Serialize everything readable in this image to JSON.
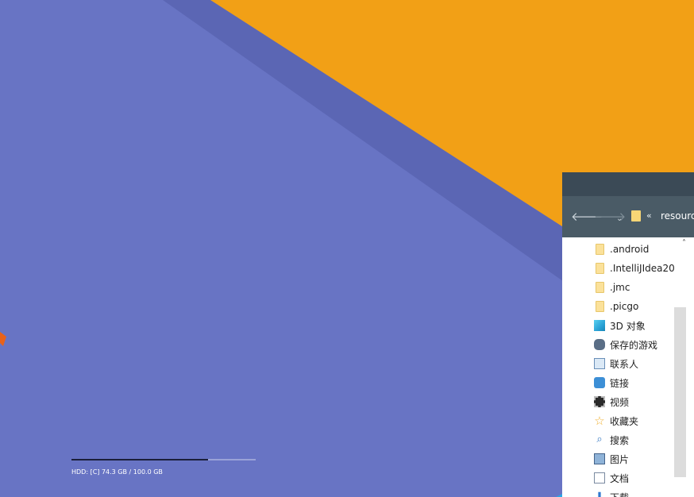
{
  "desktop": {
    "colors": {
      "background": "#6874c4",
      "shadow": "#5b66b4",
      "accent": "#f2a016",
      "blue_corner": "#29a6e6"
    },
    "hdd_widget": {
      "label": "HDD: [C] 74.3 GB / 100.0 GB",
      "used_fraction": 0.743
    }
  },
  "explorer": {
    "nav": {
      "back_icon": "arrow-left",
      "forward_icon": "arrow-right",
      "recent_icon": "chevron-down",
      "address_separator": "«",
      "address_text": "resourc"
    },
    "tree_items": [
      {
        "label": ".android",
        "icon": "folder"
      },
      {
        "label": ".IntelliJIdea20",
        "icon": "folder"
      },
      {
        "label": ".jmc",
        "icon": "folder"
      },
      {
        "label": ".picgo",
        "icon": "folder"
      },
      {
        "label": "3D 对象",
        "icon": "3d-objects"
      },
      {
        "label": "保存的游戏",
        "icon": "saved-games"
      },
      {
        "label": "联系人",
        "icon": "contacts"
      },
      {
        "label": "链接",
        "icon": "links"
      },
      {
        "label": "视频",
        "icon": "videos"
      },
      {
        "label": "收藏夹",
        "icon": "favorites"
      },
      {
        "label": "搜索",
        "icon": "searches"
      },
      {
        "label": "图片",
        "icon": "pictures"
      },
      {
        "label": "文档",
        "icon": "documents"
      },
      {
        "label": "下载",
        "icon": "downloads"
      }
    ]
  }
}
